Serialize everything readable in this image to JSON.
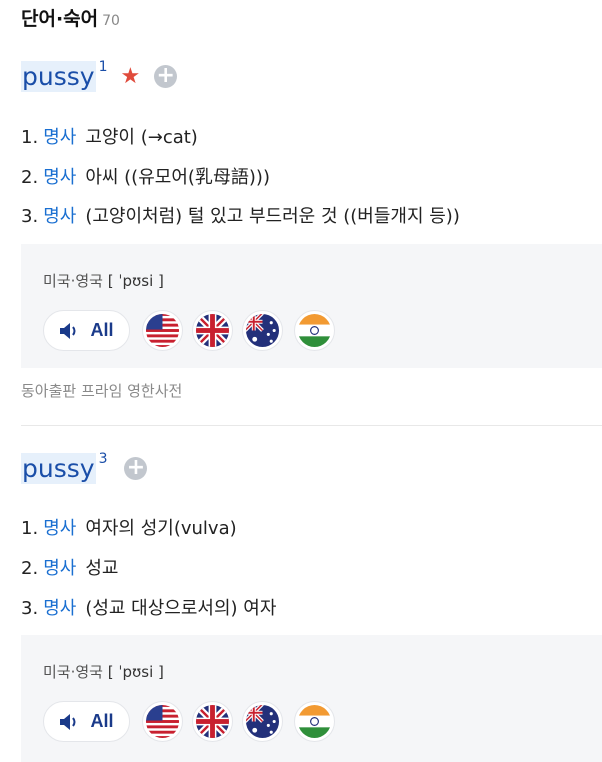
{
  "section": {
    "title": "단어·숙어",
    "count": "70"
  },
  "entries": [
    {
      "word": "pussy",
      "sup": "1",
      "definitions": [
        {
          "num": "1.",
          "pos": "명사",
          "text": "고양이 (→cat)"
        },
        {
          "num": "2.",
          "pos": "명사",
          "text": "아씨 ((유모어(乳母語)))"
        },
        {
          "num": "3.",
          "pos": "명사",
          "text": "(고양이처럼) 털 있고 부드러운 것 ((버들개지 등))"
        }
      ],
      "pron": {
        "label": "미국·영국",
        "phonetic": "[ ˈpʊsi ]",
        "all_label": "All"
      }
    },
    {
      "word": "pussy",
      "sup": "3",
      "definitions": [
        {
          "num": "1.",
          "pos": "명사",
          "text": "여자의 성기(vulva)"
        },
        {
          "num": "2.",
          "pos": "명사",
          "text": "성교"
        },
        {
          "num": "3.",
          "pos": "명사",
          "text": "(성교 대상으로서의) 여자"
        }
      ],
      "pron": {
        "label": "미국·영국",
        "phonetic": "[ ˈpʊsi ]",
        "all_label": "All"
      }
    }
  ],
  "source": "동아출판 프라임 영한사전",
  "icons": {
    "star": "star-icon",
    "add": "plus-circle-icon",
    "speaker": "speaker-icon",
    "flags": [
      "flag-us-icon",
      "flag-uk-icon",
      "flag-au-icon",
      "flag-in-icon"
    ]
  },
  "colors": {
    "accent": "#1a4ea8",
    "pos": "#1a6fd1",
    "star": "#e04b3c",
    "box": "#f5f6f8"
  }
}
